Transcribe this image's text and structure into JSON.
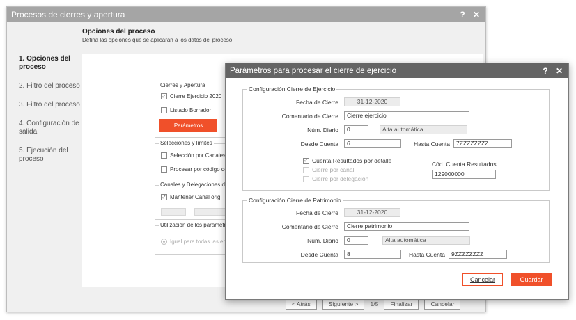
{
  "back_window": {
    "title": "Procesos de cierres y apertura",
    "help": "?",
    "close": "✕",
    "header_title": "Opciones del proceso",
    "header_subtitle": "Defina las opciones que se aplicarán a los datos del proceso",
    "steps": [
      {
        "label": "1. Opciones del proceso"
      },
      {
        "label": "2. Filtro del proceso"
      },
      {
        "label": "3. Filtro del proceso"
      },
      {
        "label": "4. Configuración de salida"
      },
      {
        "label": "5. Ejecución del proceso"
      }
    ],
    "group_cierres": {
      "legend": "Cierres y Apertura",
      "cierre_ejercicio": "Cierre Ejercicio 2020",
      "listado_borrador": "Listado Borrador",
      "parametros_button": "Parámetros"
    },
    "group_selecciones": {
      "legend": "Selecciones y  límites",
      "seleccion_canales": "Selección por Canales",
      "procesar_codigo": "Procesar por código de"
    },
    "group_canales": {
      "legend": "Canales y Delegaciones de",
      "mantener_canal": "Mantener Canal origi"
    },
    "group_parametros": {
      "legend": "Utilización de los parámetro",
      "igual_todas": "Igual para todas las em"
    },
    "footer": {
      "atras": "< Atrás",
      "siguiente": "Siguiente >",
      "page": "1/5",
      "finalizar": "Finalizar",
      "cancelar": "Cancelar"
    }
  },
  "dialog": {
    "title": "Parámetros para procesar el cierre de ejercicio",
    "help": "?",
    "close": "✕",
    "ejercicio": {
      "legend": "Configuración Cierre de Ejercicio",
      "fecha_label": "Fecha de Cierre",
      "fecha_value": "31-12-2020",
      "comentario_label": "Comentario de Cierre",
      "comentario_value": "Cierre ejercicio",
      "diario_label": "Núm. Diario",
      "diario_value": "0",
      "diario_desc": "Alta automática",
      "desde_label": "Desde Cuenta",
      "desde_value": "6",
      "hasta_label": "Hasta Cuenta",
      "hasta_value": "7ZZZZZZZZ",
      "cuenta_resultados": "Cuenta Resultados por detalle",
      "cierre_canal": "Cierre por canal",
      "cierre_delegacion": "Cierre por delegación",
      "cod_cuenta_label": "Cód. Cuenta Resultados",
      "cod_cuenta_value": "129000000"
    },
    "patrimonio": {
      "legend": "Configuración Cierre de Patrimonio",
      "fecha_label": "Fecha de Cierre",
      "fecha_value": "31-12-2020",
      "comentario_label": "Comentario de Cierre",
      "comentario_value": "Cierre patrimonio",
      "diario_label": "Núm. Diario",
      "diario_value": "0",
      "diario_desc": "Alta automática",
      "desde_label": "Desde Cuenta",
      "desde_value": "8",
      "hasta_label": "Hasta Cuenta",
      "hasta_value": "9ZZZZZZZZ"
    },
    "cancel_button": "Cancelar",
    "save_button": "Guardar"
  },
  "colors": {
    "accent": "#f0502a",
    "back_titlebar": "#a5a5a5",
    "dialog_titlebar": "#646464"
  }
}
